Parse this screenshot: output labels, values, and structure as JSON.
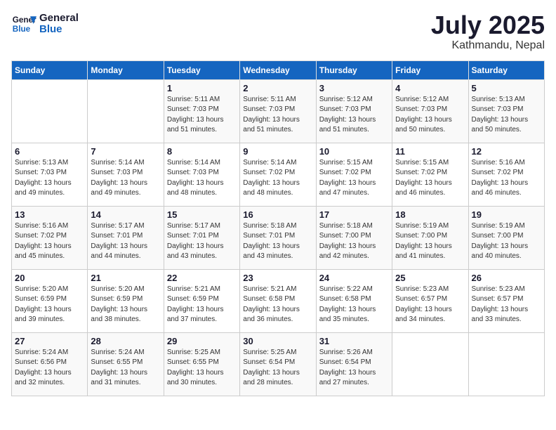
{
  "logo": {
    "line1": "General",
    "line2": "Blue"
  },
  "title": "July 2025",
  "location": "Kathmandu, Nepal",
  "headers": [
    "Sunday",
    "Monday",
    "Tuesday",
    "Wednesday",
    "Thursday",
    "Friday",
    "Saturday"
  ],
  "weeks": [
    [
      {
        "day": "",
        "detail": ""
      },
      {
        "day": "",
        "detail": ""
      },
      {
        "day": "1",
        "detail": "Sunrise: 5:11 AM\nSunset: 7:03 PM\nDaylight: 13 hours and 51 minutes."
      },
      {
        "day": "2",
        "detail": "Sunrise: 5:11 AM\nSunset: 7:03 PM\nDaylight: 13 hours and 51 minutes."
      },
      {
        "day": "3",
        "detail": "Sunrise: 5:12 AM\nSunset: 7:03 PM\nDaylight: 13 hours and 51 minutes."
      },
      {
        "day": "4",
        "detail": "Sunrise: 5:12 AM\nSunset: 7:03 PM\nDaylight: 13 hours and 50 minutes."
      },
      {
        "day": "5",
        "detail": "Sunrise: 5:13 AM\nSunset: 7:03 PM\nDaylight: 13 hours and 50 minutes."
      }
    ],
    [
      {
        "day": "6",
        "detail": "Sunrise: 5:13 AM\nSunset: 7:03 PM\nDaylight: 13 hours and 49 minutes."
      },
      {
        "day": "7",
        "detail": "Sunrise: 5:14 AM\nSunset: 7:03 PM\nDaylight: 13 hours and 49 minutes."
      },
      {
        "day": "8",
        "detail": "Sunrise: 5:14 AM\nSunset: 7:03 PM\nDaylight: 13 hours and 48 minutes."
      },
      {
        "day": "9",
        "detail": "Sunrise: 5:14 AM\nSunset: 7:02 PM\nDaylight: 13 hours and 48 minutes."
      },
      {
        "day": "10",
        "detail": "Sunrise: 5:15 AM\nSunset: 7:02 PM\nDaylight: 13 hours and 47 minutes."
      },
      {
        "day": "11",
        "detail": "Sunrise: 5:15 AM\nSunset: 7:02 PM\nDaylight: 13 hours and 46 minutes."
      },
      {
        "day": "12",
        "detail": "Sunrise: 5:16 AM\nSunset: 7:02 PM\nDaylight: 13 hours and 46 minutes."
      }
    ],
    [
      {
        "day": "13",
        "detail": "Sunrise: 5:16 AM\nSunset: 7:02 PM\nDaylight: 13 hours and 45 minutes."
      },
      {
        "day": "14",
        "detail": "Sunrise: 5:17 AM\nSunset: 7:01 PM\nDaylight: 13 hours and 44 minutes."
      },
      {
        "day": "15",
        "detail": "Sunrise: 5:17 AM\nSunset: 7:01 PM\nDaylight: 13 hours and 43 minutes."
      },
      {
        "day": "16",
        "detail": "Sunrise: 5:18 AM\nSunset: 7:01 PM\nDaylight: 13 hours and 43 minutes."
      },
      {
        "day": "17",
        "detail": "Sunrise: 5:18 AM\nSunset: 7:00 PM\nDaylight: 13 hours and 42 minutes."
      },
      {
        "day": "18",
        "detail": "Sunrise: 5:19 AM\nSunset: 7:00 PM\nDaylight: 13 hours and 41 minutes."
      },
      {
        "day": "19",
        "detail": "Sunrise: 5:19 AM\nSunset: 7:00 PM\nDaylight: 13 hours and 40 minutes."
      }
    ],
    [
      {
        "day": "20",
        "detail": "Sunrise: 5:20 AM\nSunset: 6:59 PM\nDaylight: 13 hours and 39 minutes."
      },
      {
        "day": "21",
        "detail": "Sunrise: 5:20 AM\nSunset: 6:59 PM\nDaylight: 13 hours and 38 minutes."
      },
      {
        "day": "22",
        "detail": "Sunrise: 5:21 AM\nSunset: 6:59 PM\nDaylight: 13 hours and 37 minutes."
      },
      {
        "day": "23",
        "detail": "Sunrise: 5:21 AM\nSunset: 6:58 PM\nDaylight: 13 hours and 36 minutes."
      },
      {
        "day": "24",
        "detail": "Sunrise: 5:22 AM\nSunset: 6:58 PM\nDaylight: 13 hours and 35 minutes."
      },
      {
        "day": "25",
        "detail": "Sunrise: 5:23 AM\nSunset: 6:57 PM\nDaylight: 13 hours and 34 minutes."
      },
      {
        "day": "26",
        "detail": "Sunrise: 5:23 AM\nSunset: 6:57 PM\nDaylight: 13 hours and 33 minutes."
      }
    ],
    [
      {
        "day": "27",
        "detail": "Sunrise: 5:24 AM\nSunset: 6:56 PM\nDaylight: 13 hours and 32 minutes."
      },
      {
        "day": "28",
        "detail": "Sunrise: 5:24 AM\nSunset: 6:55 PM\nDaylight: 13 hours and 31 minutes."
      },
      {
        "day": "29",
        "detail": "Sunrise: 5:25 AM\nSunset: 6:55 PM\nDaylight: 13 hours and 30 minutes."
      },
      {
        "day": "30",
        "detail": "Sunrise: 5:25 AM\nSunset: 6:54 PM\nDaylight: 13 hours and 28 minutes."
      },
      {
        "day": "31",
        "detail": "Sunrise: 5:26 AM\nSunset: 6:54 PM\nDaylight: 13 hours and 27 minutes."
      },
      {
        "day": "",
        "detail": ""
      },
      {
        "day": "",
        "detail": ""
      }
    ]
  ]
}
